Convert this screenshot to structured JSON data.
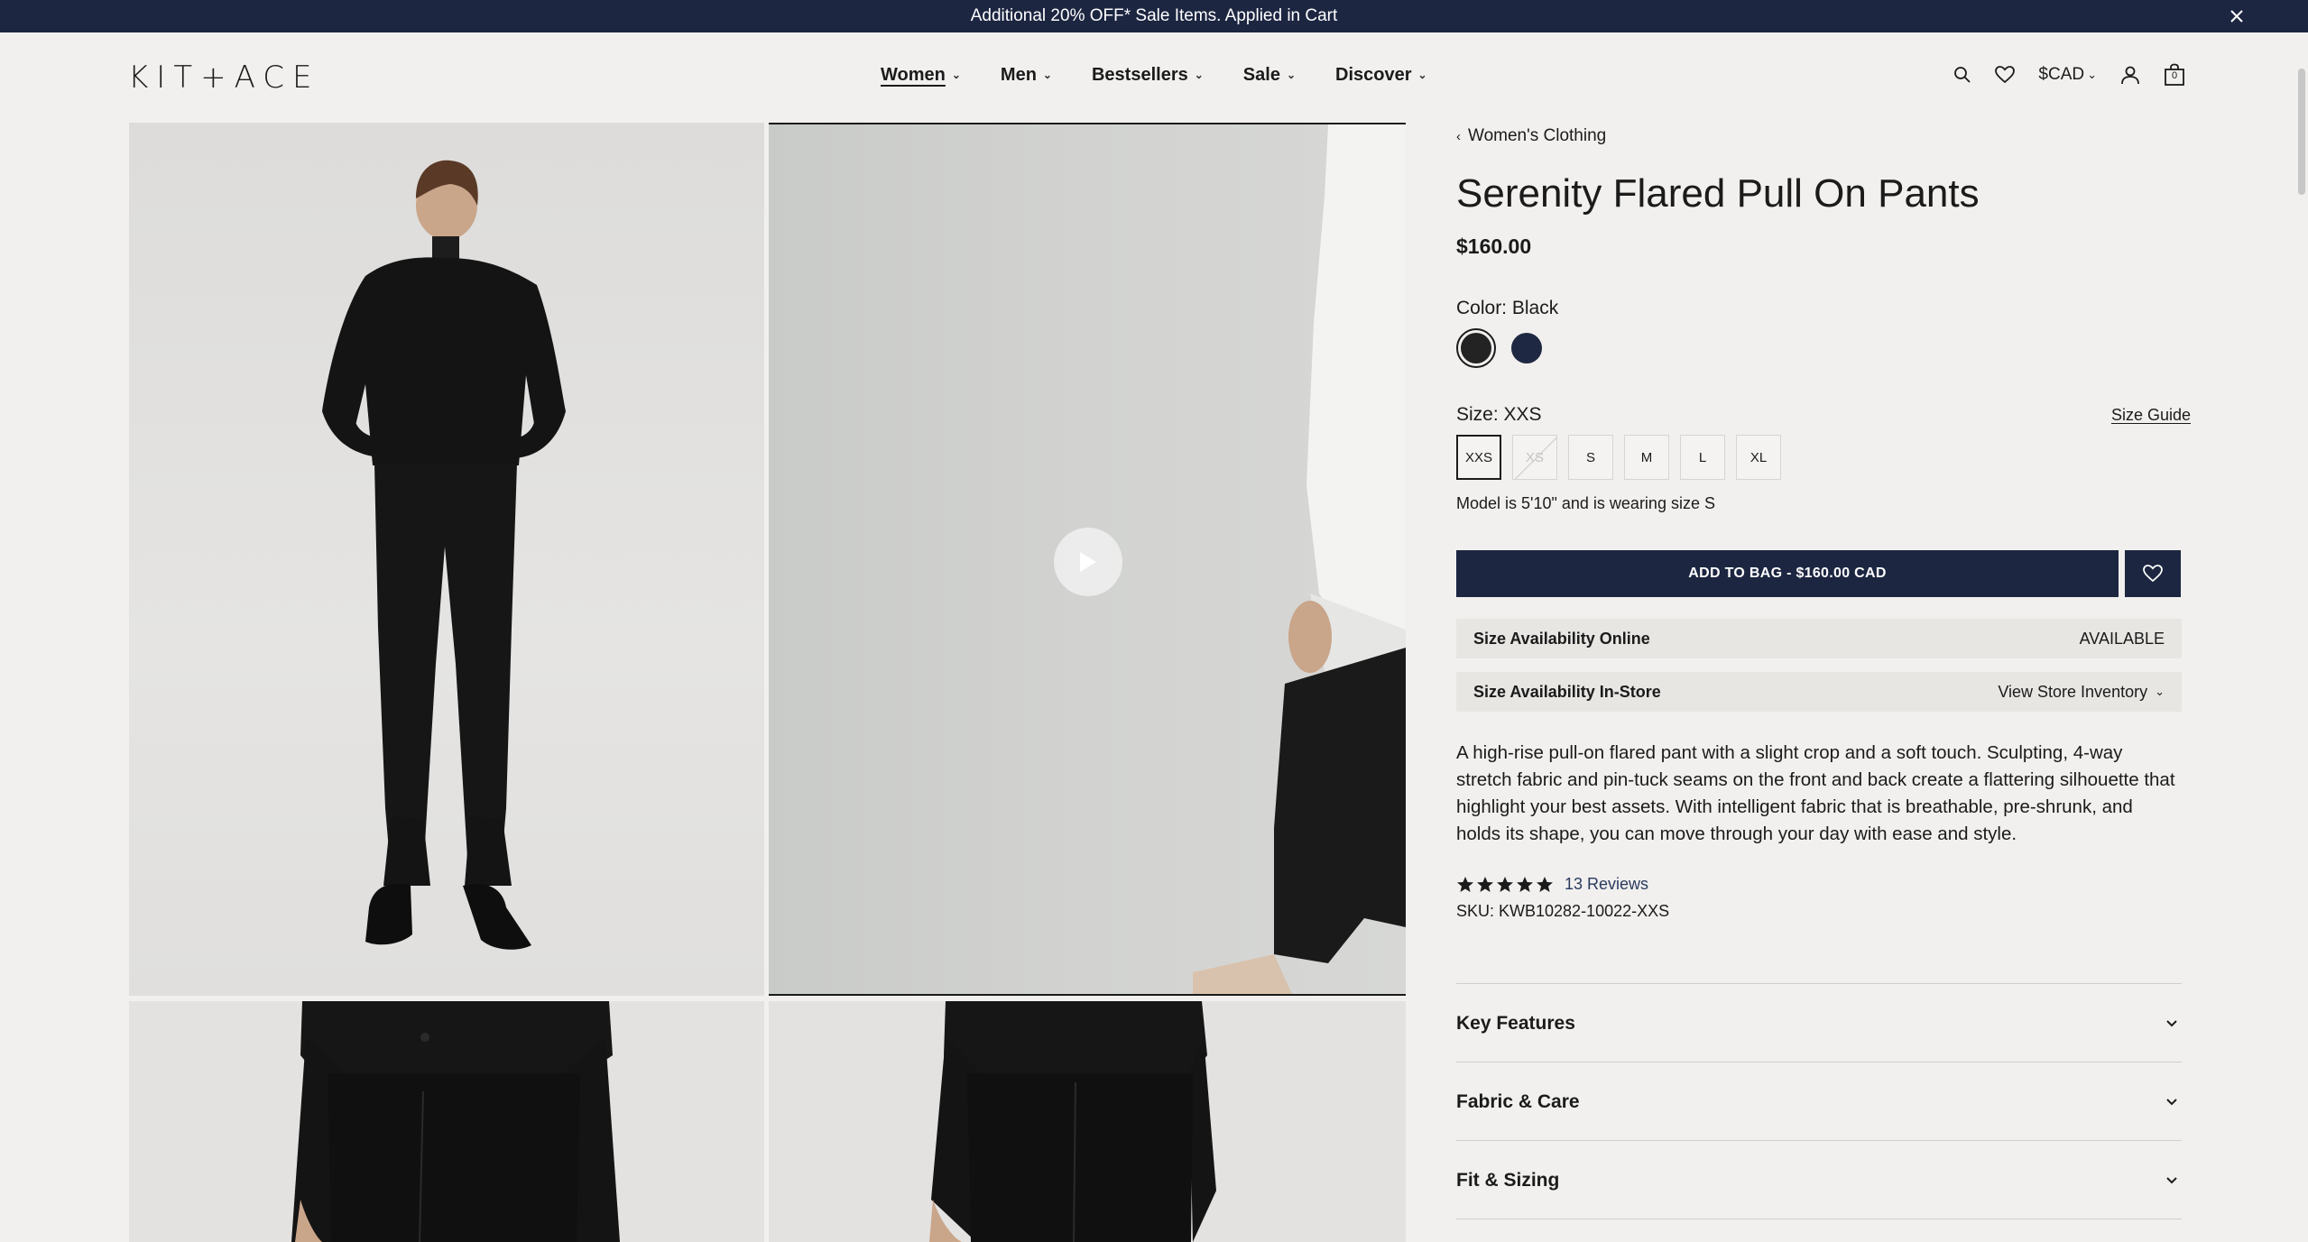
{
  "promo": {
    "text": "Additional 20% OFF* Sale Items. Applied in Cart",
    "close_icon": "close-icon"
  },
  "header": {
    "logo": "KIT+ACE",
    "nav": [
      {
        "label": "Women",
        "active": true
      },
      {
        "label": "Men",
        "active": false
      },
      {
        "label": "Bestsellers",
        "active": false
      },
      {
        "label": "Sale",
        "active": false
      },
      {
        "label": "Discover",
        "active": false
      }
    ],
    "currency": "$CAD",
    "icons": [
      "search-icon",
      "heart-icon",
      "account-icon",
      "bag-icon"
    ],
    "bag_count": "0"
  },
  "gallery": {
    "video_play_icon": "play-icon"
  },
  "product": {
    "breadcrumb": "Women's Clothing",
    "title": "Serenity Flared Pull On Pants",
    "price": "$160.00",
    "color_label": "Color: Black",
    "colors": [
      {
        "name": "Black",
        "hex": "#232323",
        "selected": true
      },
      {
        "name": "Navy",
        "hex": "#1e2842",
        "selected": false
      }
    ],
    "size_label": "Size: XXS",
    "size_guide": "Size Guide",
    "sizes": [
      {
        "label": "XXS",
        "selected": true,
        "available": true
      },
      {
        "label": "XS",
        "selected": false,
        "available": false
      },
      {
        "label": "S",
        "selected": false,
        "available": true
      },
      {
        "label": "M",
        "selected": false,
        "available": true
      },
      {
        "label": "L",
        "selected": false,
        "available": true
      },
      {
        "label": "XL",
        "selected": false,
        "available": true
      }
    ],
    "model_note": "Model is 5'10\" and is wearing size S",
    "add_to_bag": "ADD TO BAG - $160.00 CAD",
    "availability_online_label": "Size Availability Online",
    "availability_online_value": "AVAILABLE",
    "availability_store_label": "Size Availability In-Store",
    "availability_store_link": "View Store Inventory",
    "description": "A high-rise pull-on flared pant with a slight crop and a soft touch. Sculpting, 4-way stretch fabric and pin-tuck seams on the front and back create a flattering silhouette that highlight your best assets. With intelligent fabric that is breathable, pre-shrunk, and holds its shape, you can move through your day with ease and style.",
    "rating": 5,
    "reviews": "13 Reviews",
    "sku": "SKU: KWB10282-10022-XXS",
    "accordions": [
      "Key Features",
      "Fabric & Care",
      "Fit & Sizing"
    ]
  },
  "colors": {
    "navy": "#1c2641",
    "background": "#f1f0ee"
  }
}
